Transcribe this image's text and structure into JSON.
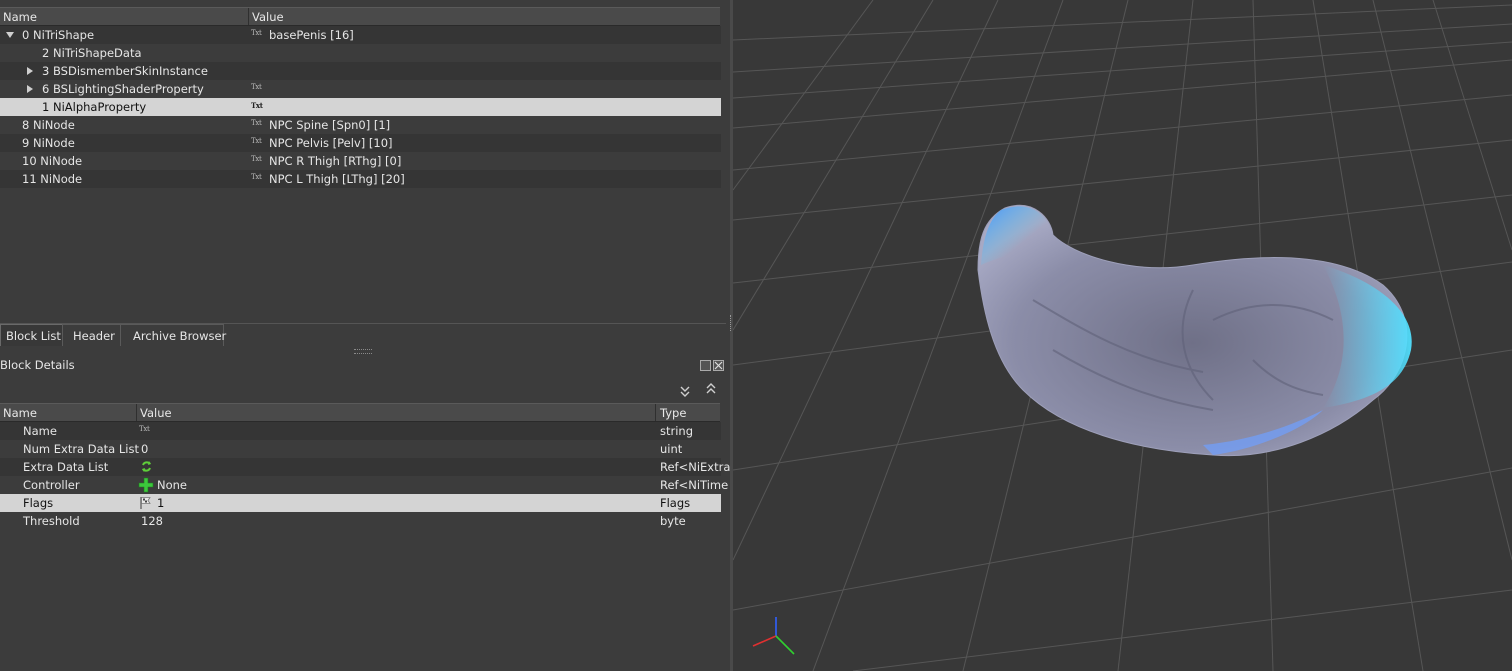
{
  "block_list": {
    "columns": [
      "Name",
      "Value"
    ],
    "rows": [
      {
        "name": "0 NiTriShape",
        "value": "basePenis [16]",
        "txt": "Txt"
      },
      {
        "name": "2 NiTriShapeData",
        "value": "",
        "txt": ""
      },
      {
        "name": "3 BSDismemberSkinInstance",
        "value": "",
        "txt": ""
      },
      {
        "name": "6 BSLightingShaderProperty",
        "value": "",
        "txt": "Txt"
      },
      {
        "name": "1 NiAlphaProperty",
        "value": "",
        "txt": "Txt"
      },
      {
        "name": "8 NiNode",
        "value": "NPC Spine [Spn0] [1]",
        "txt": "Txt"
      },
      {
        "name": "9 NiNode",
        "value": "NPC Pelvis [Pelv] [10]",
        "txt": "Txt"
      },
      {
        "name": "10 NiNode",
        "value": "NPC R Thigh [RThg] [0]",
        "txt": "Txt"
      },
      {
        "name": "11 NiNode",
        "value": "NPC L Thigh [LThg] [20]",
        "txt": "Txt"
      }
    ]
  },
  "tabs": [
    "Block List",
    "Header",
    "Archive Browser"
  ],
  "details": {
    "title": "Block Details",
    "columns": [
      "Name",
      "Value",
      "Type"
    ],
    "rows": [
      {
        "name": "Name",
        "value": "",
        "type": "string",
        "icon": "Txt"
      },
      {
        "name": "Num Extra Data List",
        "value": "0",
        "type": "uint",
        "icon": ""
      },
      {
        "name": "Extra Data List",
        "value": "",
        "type": "Ref<NiExtra",
        "icon": ""
      },
      {
        "name": "Controller",
        "value": "None",
        "type": "Ref<NiTime",
        "icon": ""
      },
      {
        "name": "Flags",
        "value": "1",
        "type": "Flags",
        "icon": ""
      },
      {
        "name": "Threshold",
        "value": "128",
        "type": "byte",
        "icon": ""
      }
    ]
  },
  "icons": {
    "expand": "triangle-expand-icon",
    "collapse": "triangle-collapse-icon",
    "txt": "txt-string-icon",
    "refresh": "refresh-icon",
    "add": "plus-icon",
    "flag": "flag-icon",
    "float": "float-window-icon",
    "close": "close-icon",
    "collapse_all": "collapse-all-icon",
    "expand_all": "expand-all-icon",
    "axes": "axes-gizmo-icon"
  },
  "colors": {
    "selection": "#d4d4d4",
    "viewport_bg": "#383838",
    "grid": "#5a5a5a",
    "mesh_base": "#8a8ca8",
    "mesh_glow": "#4fd8ff",
    "axis_x": "#e03030",
    "axis_y": "#30d030",
    "axis_z": "#3060ff"
  }
}
